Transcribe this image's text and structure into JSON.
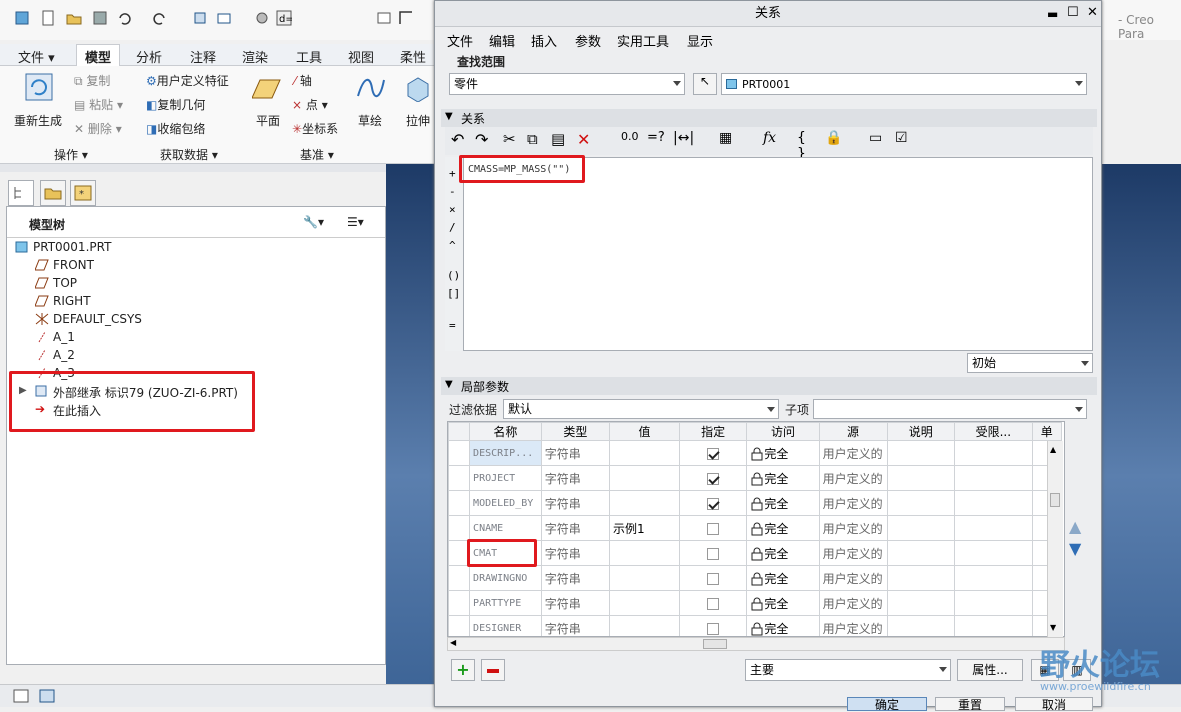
{
  "main": {
    "ribbon_tabs": [
      "文件 ▾",
      "模型",
      "分析",
      "注释",
      "渲染",
      "工具",
      "视图",
      "柔性"
    ],
    "ops": {
      "regen": "重新生成",
      "copy": "复制",
      "paste": "粘贴 ▾",
      "delete": "删除 ▾",
      "udf": "用户定义特征",
      "copy_geom": "复制几何",
      "shrinkwrap": "收缩包络",
      "plane": "平面",
      "axis": "轴",
      "point": "点 ▾",
      "csys": "坐标系",
      "sketch": "草绘",
      "extrude": "拉伸"
    },
    "groups": {
      "operations": "操作 ▾",
      "get_data": "获取数据 ▾",
      "datum": "基准 ▾"
    },
    "tree_title": "模型树",
    "tree_items": [
      "PRT0001.PRT",
      "FRONT",
      "TOP",
      "RIGHT",
      "DEFAULT_CSYS",
      "A_1",
      "A_2",
      "A_3",
      "外部继承 标识79 (ZUO-ZI-6.PRT)",
      "在此插入"
    ],
    "app_title": "- Creo Para"
  },
  "dialog": {
    "title": "关系",
    "menu": [
      "文件",
      "编辑",
      "插入",
      "参数",
      "实用工具",
      "显示"
    ],
    "lookup_label": "查找范围",
    "lookup_type": "零件",
    "lookup_value": "PRT0001",
    "relations_label": "关系",
    "relation_text": "CMASS=MP_MASS(\"\")",
    "ops": [
      "+",
      "-",
      "×",
      "/",
      "^",
      "()",
      "[]",
      "="
    ],
    "init_combo": "初始",
    "local_params_label": "局部参数",
    "filter_label": "过滤依据",
    "filter_value": "默认",
    "sub_label": "子项",
    "columns": [
      "名称",
      "类型",
      "值",
      "指定",
      "访问",
      "源",
      "说明",
      "受限...",
      "单"
    ],
    "rows": [
      {
        "name": "DESCRIP...",
        "type": "字符串",
        "value": "",
        "designated": true,
        "access": "完全",
        "source": "用户定义的"
      },
      {
        "name": "PROJECT",
        "type": "字符串",
        "value": "",
        "designated": true,
        "access": "完全",
        "source": "用户定义的"
      },
      {
        "name": "MODELED_BY",
        "type": "字符串",
        "value": "",
        "designated": true,
        "access": "完全",
        "source": "用户定义的"
      },
      {
        "name": "CNAME",
        "type": "字符串",
        "value": "示例1",
        "designated": false,
        "access": "完全",
        "source": "用户定义的"
      },
      {
        "name": "CMAT",
        "type": "字符串",
        "value": "",
        "designated": false,
        "access": "完全",
        "source": "用户定义的"
      },
      {
        "name": "DRAWINGNO",
        "type": "字符串",
        "value": "",
        "designated": false,
        "access": "完全",
        "source": "用户定义的"
      },
      {
        "name": "PARTTYPE",
        "type": "字符串",
        "value": "",
        "designated": false,
        "access": "完全",
        "source": "用户定义的"
      },
      {
        "name": "DESIGNER",
        "type": "字符串",
        "value": "",
        "designated": false,
        "access": "完全",
        "source": "用户定义的"
      }
    ],
    "main_combo": "主要",
    "props_btn": "属性...",
    "ok": "确定",
    "reset": "重置",
    "cancel": "取消"
  },
  "watermark": {
    "cn": "野火论坛",
    "url": "www.proewildfire.cn"
  },
  "colors": {
    "accent_red": "#e0191e",
    "bg_blue": "#3e6597"
  }
}
